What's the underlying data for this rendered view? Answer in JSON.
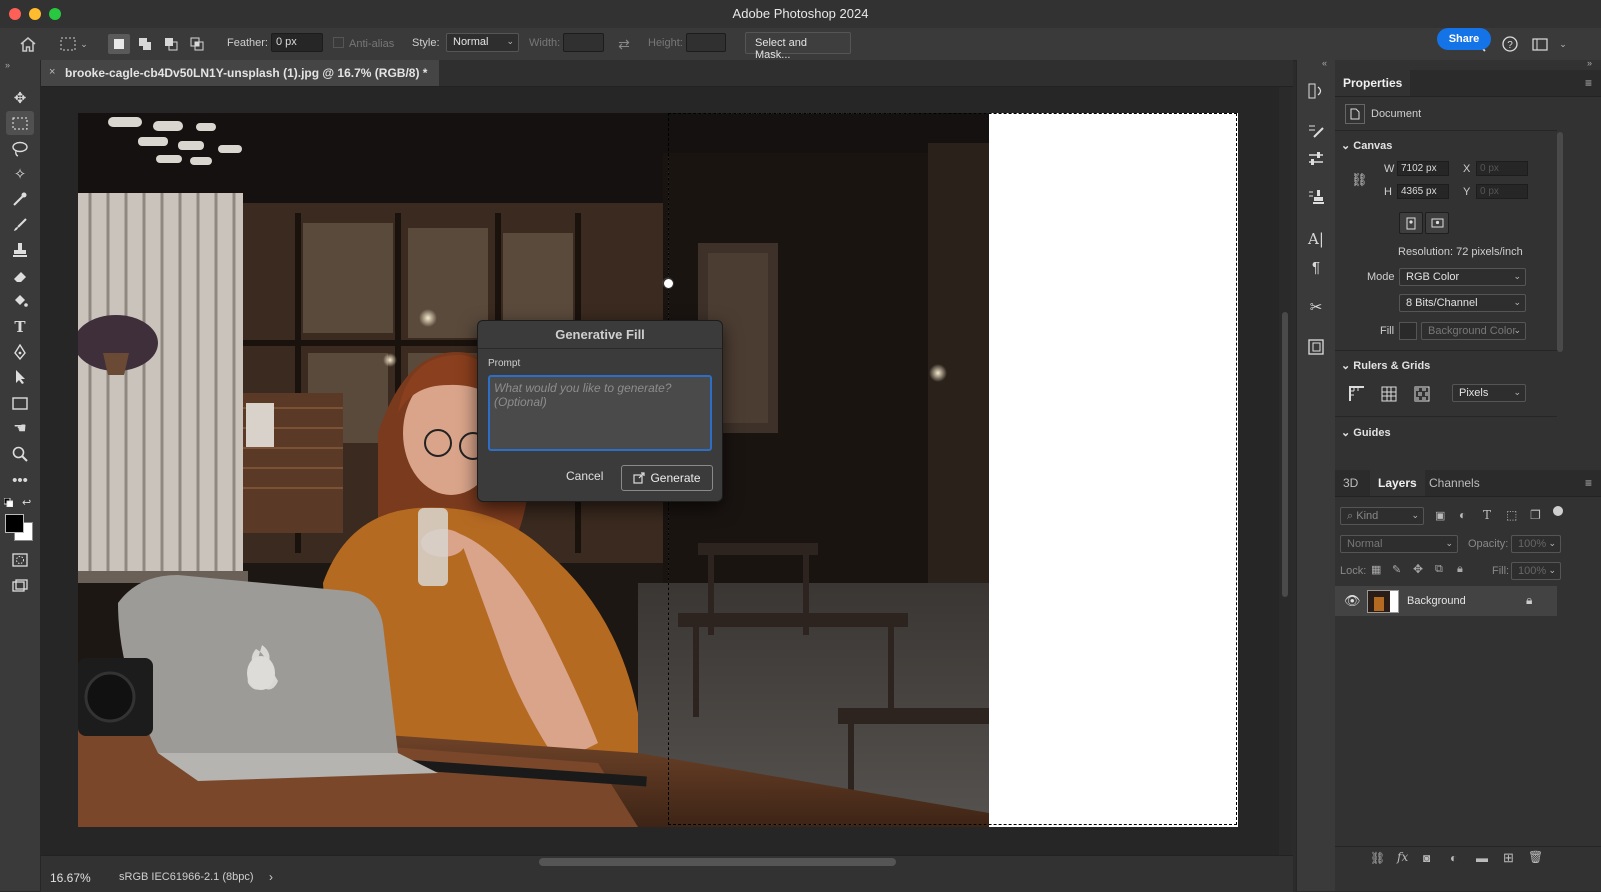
{
  "app": {
    "title": "Adobe Photoshop 2024"
  },
  "options": {
    "feather_label": "Feather:",
    "feather_value": "0 px",
    "antialias_label": "Anti-alias",
    "style_label": "Style:",
    "style_value": "Normal",
    "width_label": "Width:",
    "height_label": "Height:",
    "select_mask_label": "Select and Mask...",
    "share_label": "Share"
  },
  "document": {
    "tab_title": "brooke-cagle-cb4Dv50LN1Y-unsplash (1).jpg @ 16.7% (RGB/8) *",
    "zoom": "16.67%",
    "color_profile": "sRGB IEC61966-2.1 (8bpc)"
  },
  "generative_fill": {
    "title": "Generative Fill",
    "prompt_label": "Prompt",
    "placeholder": "What would you like to generate? (Optional)",
    "cancel_label": "Cancel",
    "generate_label": "Generate"
  },
  "properties": {
    "tab_label": "Properties",
    "doc_label": "Document",
    "canvas_section": "Canvas",
    "w_label": "W",
    "w_value": "7102 px",
    "h_label": "H",
    "h_value": "4365 px",
    "x_label": "X",
    "x_placeholder": "0 px",
    "y_label": "Y",
    "y_placeholder": "0 px",
    "resolution": "Resolution: 72 pixels/inch",
    "mode_label": "Mode",
    "mode_value": "RGB Color",
    "bits_value": "8 Bits/Channel",
    "fill_label": "Fill",
    "fill_value": "Background Color",
    "rulers_section": "Rulers & Grids",
    "units_value": "Pixels",
    "guides_section": "Guides"
  },
  "layers_panel": {
    "tabs": [
      "3D",
      "Layers",
      "Channels"
    ],
    "kind_label": "Kind",
    "blend_value": "Normal",
    "opacity_label": "Opacity:",
    "opacity_value": "100%",
    "lock_label": "Lock:",
    "fill_label": "Fill:",
    "fill_value": "100%",
    "layers": [
      {
        "name": "Background"
      }
    ]
  },
  "colors": {
    "accent": "#1473e6",
    "selection": "#2d6fc4"
  }
}
